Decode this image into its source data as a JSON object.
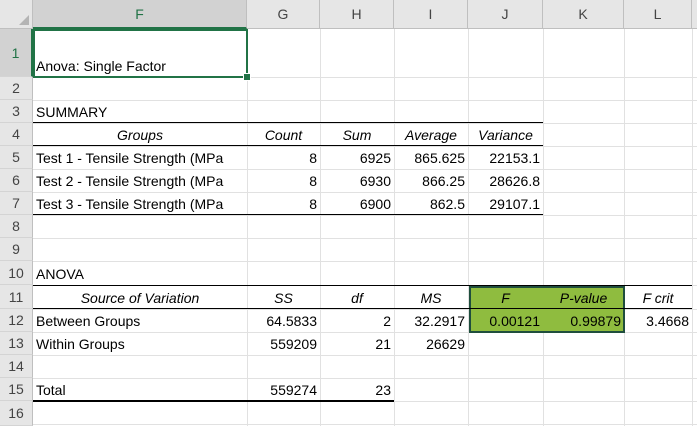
{
  "columns": [
    "F",
    "G",
    "H",
    "I",
    "J",
    "K",
    "L"
  ],
  "rows": [
    "1",
    "2",
    "3",
    "4",
    "5",
    "6",
    "7",
    "8",
    "9",
    "10",
    "11",
    "12",
    "13",
    "14",
    "15",
    "16"
  ],
  "cells": {
    "f1": "Anova: Single Factor",
    "f3": "SUMMARY",
    "summary_headers": [
      "Groups",
      "Count",
      "Sum",
      "Average",
      "Variance"
    ],
    "summary_rows": [
      [
        "Test 1 - Tensile Strength (MPa",
        "8",
        "6925",
        "865.625",
        "22153.1"
      ],
      [
        "Test 2 - Tensile Strength (MPa",
        "8",
        "6930",
        "866.25",
        "28626.8"
      ],
      [
        "Test 3 - Tensile Strength (MPa",
        "8",
        "6900",
        "862.5",
        "29107.1"
      ]
    ],
    "f10": "ANOVA",
    "anova_headers": [
      "Source of Variation",
      "SS",
      "df",
      "MS",
      "F",
      "P-value",
      "F crit"
    ],
    "between": [
      "Between Groups",
      "64.5833",
      "2",
      "32.2917",
      "0.00121",
      "0.99879",
      "3.4668"
    ],
    "within": [
      "Within Groups",
      "559209",
      "21",
      "26629"
    ],
    "total": [
      "Total",
      "559274",
      "23"
    ]
  },
  "colors": {
    "highlight": "#8fbc3f",
    "highlight_border": "#1f4e3d",
    "selection": "#217346"
  }
}
